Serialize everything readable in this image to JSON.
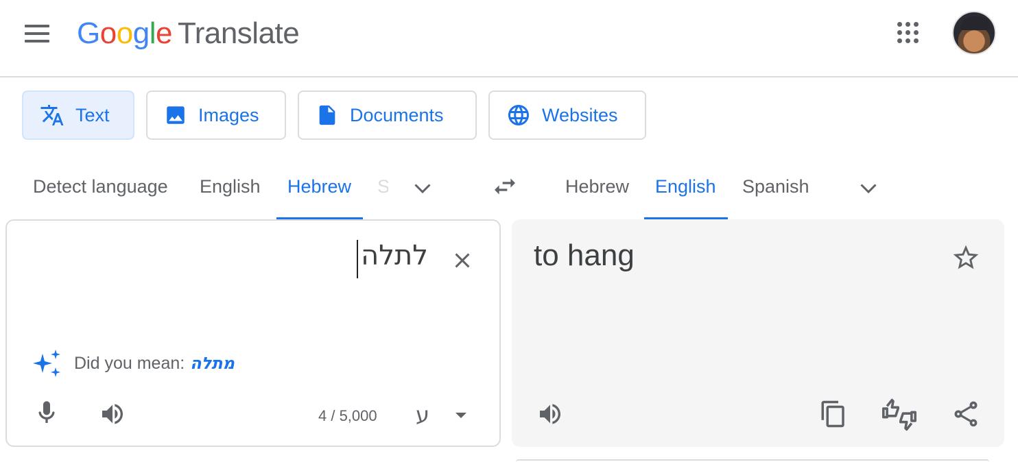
{
  "header": {
    "logo_letters": [
      "G",
      "o",
      "o",
      "g",
      "l",
      "e"
    ],
    "product": "Translate",
    "menu_icon": "hamburger-menu-icon",
    "apps_icon": "apps-grid-icon",
    "avatar_icon": "user-avatar"
  },
  "modes": [
    {
      "label": "Text",
      "icon": "translate-icon",
      "active": true
    },
    {
      "label": "Images",
      "icon": "image-icon",
      "active": false
    },
    {
      "label": "Documents",
      "icon": "document-icon",
      "active": false
    },
    {
      "label": "Websites",
      "icon": "globe-icon",
      "active": false
    }
  ],
  "source_langs": {
    "detect": "Detect language",
    "english": "English",
    "hebrew": "Hebrew",
    "partial": "S"
  },
  "target_langs": {
    "hebrew": "Hebrew",
    "english": "English",
    "spanish": "Spanish"
  },
  "source": {
    "text": "לתלה",
    "did_you_mean_label": "Did you mean:",
    "suggestion": "מתלה",
    "char_count": "4 / 5,000",
    "keyboard_char": "ע"
  },
  "target": {
    "text": "to hang"
  },
  "colors": {
    "accent": "#1a73e8",
    "active_mode_bg": "#e8f0fe",
    "panel_bg": "#f5f5f5",
    "icon_gray": "#5f6368"
  }
}
